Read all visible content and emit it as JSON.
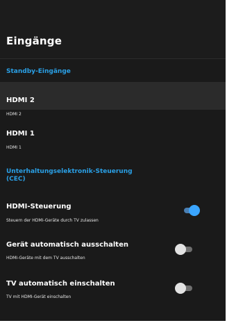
{
  "page": {
    "title": "Eingänge"
  },
  "sections": {
    "standby": {
      "label": "Standby-Eingänge",
      "items": [
        {
          "title": "HDMI 2",
          "subtitle": "HDMI 2",
          "selected": true
        },
        {
          "title": "HDMI 1",
          "subtitle": "HDMI 1",
          "selected": false
        }
      ]
    },
    "cec": {
      "label_line1": "Unterhaltungselektronik-Steuerung",
      "label_line2": "(CEC)",
      "items": [
        {
          "title": "HDMI-Steuerung",
          "subtitle": "Steuern der HDMI-Geräte durch TV zulassen",
          "toggle": "on"
        },
        {
          "title": "Gerät automatisch ausschalten",
          "subtitle": "HDMI-Geräte mit dem TV ausschalten",
          "toggle": "off"
        },
        {
          "title": "TV automatisch einschalten",
          "subtitle": "TV mit HDMI-Gerät einschalten",
          "toggle": "off"
        }
      ]
    }
  },
  "colors": {
    "background": "#1a1a1a",
    "accent": "#2aa0e6",
    "toggle_on": "#3aa5ff",
    "toggle_off": "#e3e3e3"
  }
}
